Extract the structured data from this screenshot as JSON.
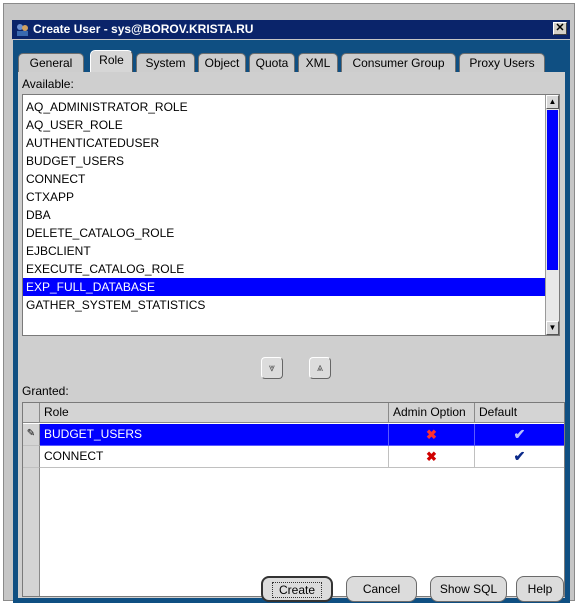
{
  "window": {
    "title": "Create User - sys@BOROV.KRISTA.RU",
    "close_glyph": "✕"
  },
  "tabs": [
    "General",
    "Role",
    "System",
    "Object",
    "Quota",
    "XML",
    "Consumer Group",
    "Proxy Users"
  ],
  "active_tab": "Role",
  "available": {
    "label": "Available:",
    "items": [
      "AQ_ADMINISTRATOR_ROLE",
      "AQ_USER_ROLE",
      "AUTHENTICATEDUSER",
      "BUDGET_USERS",
      "CONNECT",
      "CTXAPP",
      "DBA",
      "DELETE_CATALOG_ROLE",
      "EJBCLIENT",
      "EXECUTE_CATALOG_ROLE",
      "EXP_FULL_DATABASE",
      "GATHER_SYSTEM_STATISTICS"
    ],
    "selected": "EXP_FULL_DATABASE"
  },
  "move_buttons": {
    "down": "⩔",
    "up": "⩓"
  },
  "granted": {
    "label": "Granted:",
    "columns": [
      "Role",
      "Admin Option",
      "Default"
    ],
    "rows": [
      {
        "role": "BUDGET_USERS",
        "admin": "✖",
        "default": "✔",
        "selected": true
      },
      {
        "role": "CONNECT",
        "admin": "✖",
        "default": "✔",
        "selected": false
      }
    ]
  },
  "buttons": {
    "create": "Create",
    "cancel": "Cancel",
    "show_sql": "Show SQL",
    "help": "Help"
  },
  "colors": {
    "title_bar": "#0a246a",
    "frame": "#0f4f82",
    "selection": "#0000ff",
    "admin_x": "#d00000",
    "default_check": "#0b2a8a"
  }
}
